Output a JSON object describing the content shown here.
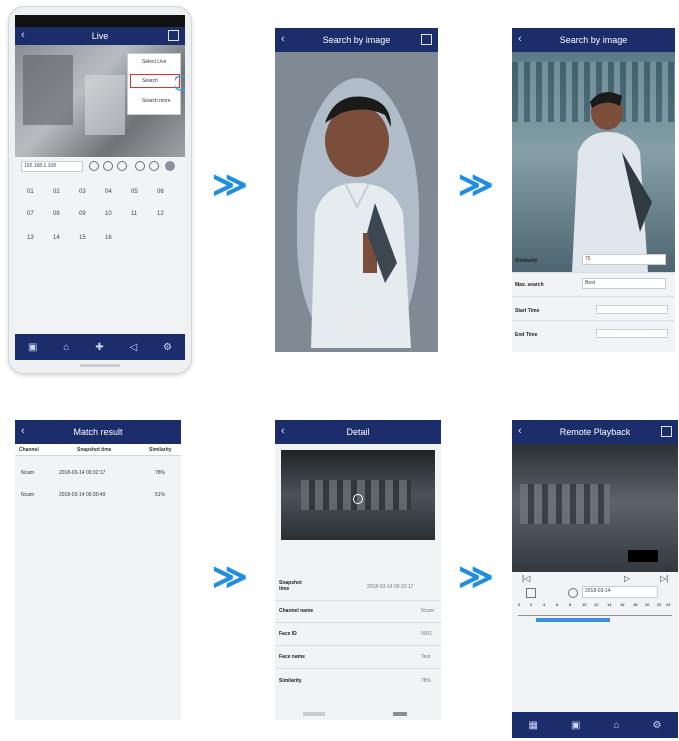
{
  "screens": {
    "live": {
      "title": "Live",
      "menu": [
        "Select Live",
        "Search",
        "Search more"
      ],
      "device_field": "192.168.1.108",
      "channels": [
        "01",
        "02",
        "03",
        "04",
        "05",
        "06",
        "07",
        "08",
        "09",
        "10",
        "11",
        "12",
        "13",
        "14",
        "15",
        "16"
      ]
    },
    "search_by_image_1": {
      "title": "Search by image"
    },
    "search_by_image_2": {
      "title": "Search by image",
      "fields": [
        {
          "label": "Similarity",
          "value": "75"
        },
        {
          "label": "Max. search",
          "value": "Best"
        },
        {
          "label": "Start Time",
          "value": ""
        },
        {
          "label": "End Time",
          "value": ""
        }
      ]
    },
    "match_result": {
      "title": "Match result",
      "columns": [
        "Channel",
        "Snapshot time",
        "Similarity"
      ],
      "rows": [
        {
          "channel": "Ncam",
          "time": "2018-03-14 09:32:17",
          "similarity": "78%"
        },
        {
          "channel": "Ncam",
          "time": "2018-03-14 09:30:49",
          "similarity": "51%"
        }
      ]
    },
    "detail": {
      "title": "Detail",
      "rows": [
        {
          "label": "Snapshot time",
          "value": "2018-03-14 09:32:17"
        },
        {
          "label": "Channel name",
          "value": "Ncam"
        },
        {
          "label": "Face ID",
          "value": "0001"
        },
        {
          "label": "Face name",
          "value": "Test"
        },
        {
          "label": "Similarity",
          "value": "78%"
        }
      ]
    },
    "remote_playback": {
      "title": "Remote Playback",
      "date": "2018-03-14",
      "timeline_ticks": [
        "0",
        "2",
        "4",
        "6",
        "8",
        "10",
        "12",
        "14",
        "16",
        "18",
        "20",
        "22",
        "24"
      ]
    }
  },
  "arrows": [
    "≫",
    "≫",
    "≫",
    "≫"
  ],
  "colors": {
    "navbar": "#1c2d6b",
    "arrow": "#1f8de0",
    "highlight": "#e0322b"
  }
}
